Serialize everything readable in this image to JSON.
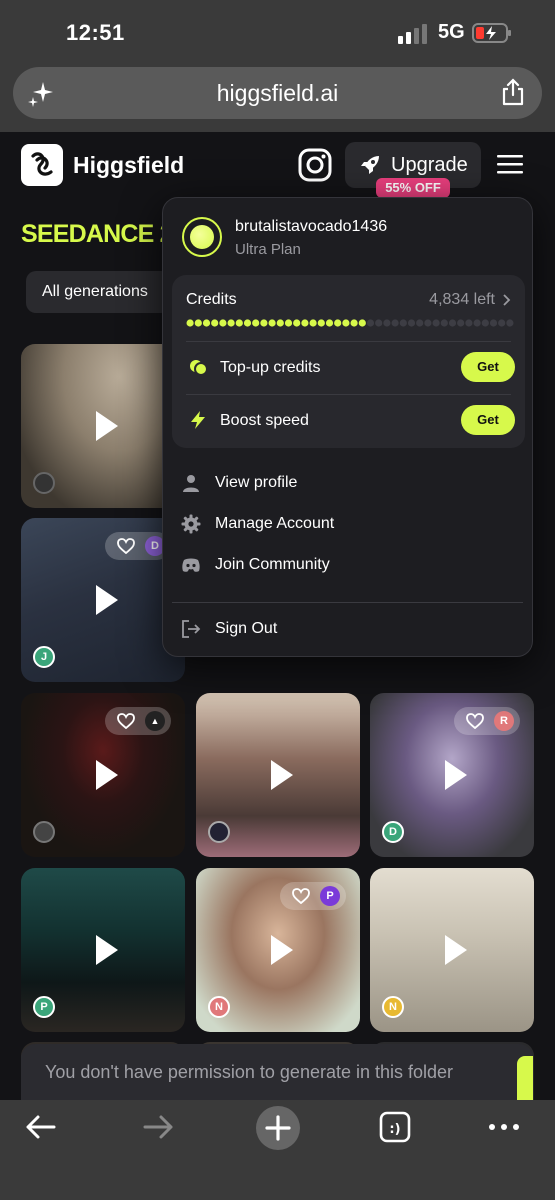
{
  "status": {
    "time": "12:51",
    "network": "5G"
  },
  "browser": {
    "url": "higgsfield.ai"
  },
  "app": {
    "brand": "Higgsfield",
    "upgrade_label": "Upgrade",
    "discount_badge": "55% OFF",
    "section_title": "SEEDANCE 2.",
    "filter_label": "All generations"
  },
  "dropdown": {
    "username": "brutalistavocado1436",
    "plan": "Ultra Plan",
    "credits_label": "Credits",
    "credits_left": "4,834 left",
    "credits_fraction": 0.55,
    "topup_label": "Top-up credits",
    "topup_button": "Get",
    "boost_label": "Boost speed",
    "boost_button": "Get",
    "menu": [
      {
        "label": "View profile",
        "icon": "person-icon"
      },
      {
        "label": "Manage Account",
        "icon": "gear-icon"
      },
      {
        "label": "Join Community",
        "icon": "discord-icon"
      },
      {
        "label": "Sign Out",
        "icon": "sign-out-icon"
      }
    ]
  },
  "tiles": [
    {
      "avatar": "",
      "avatar_color": "#333333",
      "like_badge": ""
    },
    {
      "avatar": "J",
      "avatar_color": "#3aa57a",
      "like_badge": "D",
      "like_color": "#8e62d9"
    },
    {
      "avatar": "",
      "avatar_color": "#333333",
      "like_badge": "▲",
      "like_color": "#222222"
    },
    {
      "avatar": "",
      "avatar_color": "#333333",
      "like_badge": ""
    },
    {
      "avatar": "D",
      "avatar_color": "#3aa57a",
      "like_badge": "R",
      "like_color": "#e0787a"
    },
    {
      "avatar": "P",
      "avatar_color": "#3aa57a",
      "like_badge": ""
    },
    {
      "avatar": "N",
      "avatar_color": "#e0787a",
      "like_badge": "P",
      "like_color": "#7a3ad9"
    },
    {
      "avatar": "N",
      "avatar_color": "#e8b931",
      "like_badge": ""
    }
  ],
  "toast": {
    "message": "You don't have permission to generate in this folder"
  },
  "colors": {
    "accent": "#d7f94b",
    "badge": "#ea3f7e",
    "background": "#131316"
  }
}
